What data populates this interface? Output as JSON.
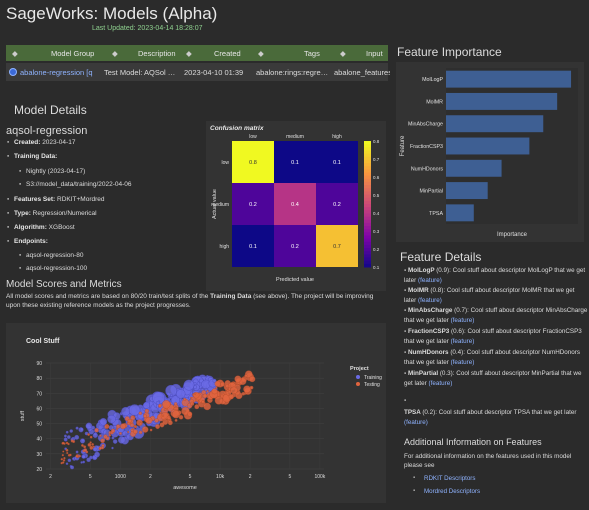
{
  "page": {
    "title": "SageWorks: Models (Alpha)",
    "updated": "Last Updated: 2023-04-14 18:28:07"
  },
  "model_table": {
    "headers": [
      "Model Group",
      "Description",
      "Created",
      "Tags",
      "Input"
    ],
    "row": [
      "abalone-regression [q",
      "Test Model: AQSol …",
      "2023-04-10 01:39",
      "abalone:rings:regre…",
      "abalone_features"
    ]
  },
  "model_details": {
    "heading": "Model Details",
    "name": "aqsol-regression",
    "created_label": "Created:",
    "created": "2023-04-17",
    "training_label": "Training Data:",
    "training_items": [
      "Nightly (2023-04-17)",
      "S3://model_data/training/2022-04-06"
    ],
    "features_label": "Features Set:",
    "features": "RDKIT+Mordred",
    "type_label": "Type:",
    "type": "Regression/Numerical",
    "algorithm_label": "Algorithm:",
    "algorithm": "XGBoost",
    "endpoints_label": "Endpoints:",
    "endpoints": [
      "aqsol-regression-80",
      "aqsol-regression-100"
    ]
  },
  "scores": {
    "heading": "Model Scores and Metrics",
    "text_pre": "All model scores and metrics are based on 80/20 train/test splits of the ",
    "text_bold": "Training Data",
    "text_post": " (see above). The project will be improving upon these existing reference models as the project progresses."
  },
  "feature_importance": {
    "heading": "Feature Importance",
    "chart_data": {
      "type": "bar",
      "orientation": "horizontal",
      "categories": [
        "MolLogP",
        "MolMR",
        "MinAbsCharge",
        "FractionCSP3",
        "NumHDonors",
        "MinPartial",
        "TPSA"
      ],
      "values": [
        0.9,
        0.8,
        0.7,
        0.6,
        0.4,
        0.3,
        0.2
      ],
      "xlabel": "Importance",
      "ylabel": "Feature",
      "xlim": [
        0,
        0.95
      ],
      "color": "#3e5f93"
    }
  },
  "confusion": {
    "chart_data": {
      "type": "heatmap",
      "title": "Confusion matrix",
      "categories": [
        "low",
        "medium",
        "high"
      ],
      "values": [
        [
          0.8,
          0.1,
          0.1
        ],
        [
          0.2,
          0.4,
          0.2
        ],
        [
          0.1,
          0.2,
          0.7
        ]
      ],
      "xlabel": "Predicted value",
      "ylabel": "Actual value",
      "colorbar_ticks": [
        0.1,
        0.2,
        0.3,
        0.4,
        0.5,
        0.6,
        0.7,
        0.8
      ],
      "range": [
        0.1,
        0.8
      ]
    }
  },
  "cool_stuff": {
    "chart_data": {
      "type": "scatter",
      "title": "Cool Stuff",
      "xlabel": "awesome",
      "ylabel": "stuff",
      "x_scale": "log",
      "xlim": [
        180,
        110000
      ],
      "ylim": [
        20,
        90
      ],
      "x_ticks": [
        {
          "v": 200,
          "l": "2"
        },
        {
          "v": 500,
          "l": "5"
        },
        {
          "v": 1000,
          "l": "1000"
        },
        {
          "v": 2000,
          "l": "2"
        },
        {
          "v": 5000,
          "l": "5"
        },
        {
          "v": 10000,
          "l": "10k"
        },
        {
          "v": 20000,
          "l": "2"
        },
        {
          "v": 50000,
          "l": "5"
        },
        {
          "v": 100000,
          "l": "100k"
        }
      ],
      "y_ticks": [
        20,
        30,
        40,
        50,
        60,
        70,
        80,
        90
      ],
      "legend_title": "Project",
      "series": [
        {
          "name": "Training",
          "color": "#6a6ae6"
        },
        {
          "name": "Testing",
          "color": "#e0643e"
        }
      ]
    }
  },
  "feature_details": {
    "heading": "Feature Details",
    "items": [
      {
        "name": "MolLogP",
        "score": "(0.9):",
        "text": "Cool stuff about descriptor MolLogP that we get later",
        "link": "(feature)"
      },
      {
        "name": "MolMR",
        "score": "(0.8):",
        "text": "Cool stuff about descriptor MolMR that we get later",
        "link": "(feature)"
      },
      {
        "name": "MinAbsCharge",
        "score": "(0.7):",
        "text": "Cool stuff about descriptor MinAbsCharge that we get later",
        "link": "(feature)"
      },
      {
        "name": "FractionCSP3",
        "score": "(0.6):",
        "text": "Cool stuff about descriptor FractionCSP3 that we get later",
        "link": "(feature)"
      },
      {
        "name": "NumHDonors",
        "score": "(0.4):",
        "text": "Cool stuff about descriptor NumHDonors that we get later",
        "link": "(feature)"
      },
      {
        "name": "MinPartial",
        "score": "(0.3):",
        "text": "Cool stuff about descriptor MinPartial that we get later",
        "link": "(feature)"
      },
      {
        "name": "TPSA",
        "score": "(0.2):",
        "text": "Cool stuff about descriptor TPSA that we get later",
        "link": "(feature)"
      }
    ],
    "additional_heading": "Additional Information on Features",
    "additional_text": "For additional information on the features used in this model please see",
    "links": [
      "RDKIT Descriptors",
      "Mordred Descriptors"
    ]
  }
}
